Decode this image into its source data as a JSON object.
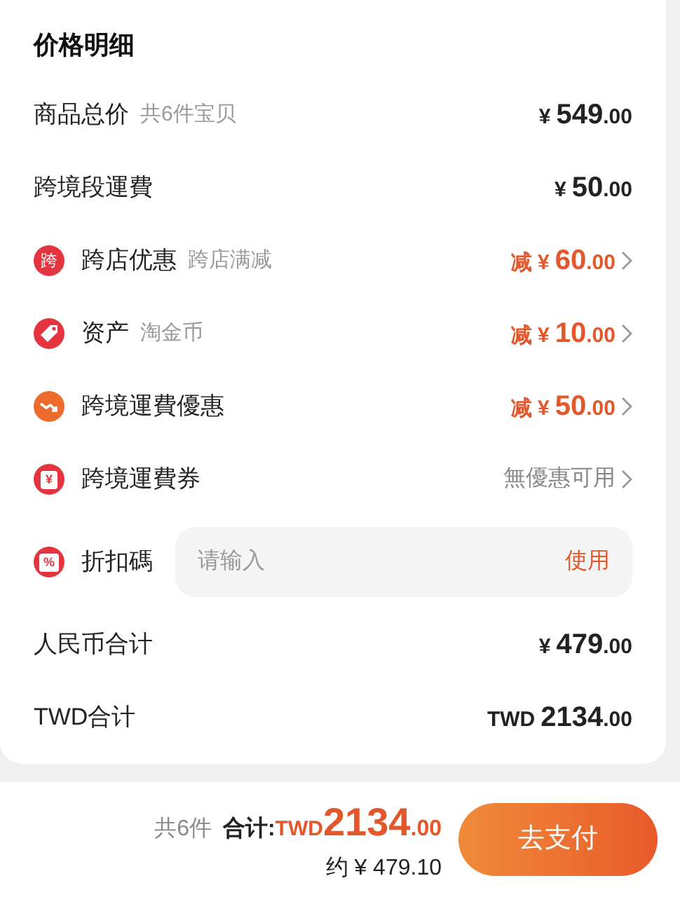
{
  "title": "价格明细",
  "rows": [
    {
      "kind": "price",
      "label": "商品总价",
      "note": "共6件宝贝",
      "prefix": "¥",
      "amount": "549",
      "cents": ".00"
    },
    {
      "kind": "price",
      "label": "跨境段運費",
      "prefix": "¥",
      "amount": "50",
      "cents": ".00"
    },
    {
      "kind": "discount",
      "icon_text": "跨",
      "label": "跨店优惠",
      "note": "跨店满减",
      "prefix": "减 ¥",
      "amount": "60",
      "cents": ".00"
    },
    {
      "kind": "discount",
      "label": "资产",
      "note": "淘金币",
      "prefix": "减 ¥",
      "amount": "10",
      "cents": ".00"
    },
    {
      "kind": "discount",
      "label": "跨境運費優惠",
      "prefix": "减 ¥",
      "amount": "50",
      "cents": ".00"
    },
    {
      "kind": "status",
      "icon_text": "¥",
      "label": "跨境運費券",
      "status": "無優惠可用"
    },
    {
      "kind": "code",
      "icon_text": "%",
      "label": "折扣碼",
      "placeholder": "请输入",
      "action": "使用"
    },
    {
      "kind": "price",
      "label": "人民币合计",
      "prefix": "¥",
      "amount": "479",
      "cents": ".00"
    },
    {
      "kind": "price",
      "label": "TWD合计",
      "prefix": "TWD",
      "amount": "2134",
      "cents": ".00"
    }
  ],
  "footer": {
    "count": "共6件",
    "total_label": "合计:",
    "currency": "TWD",
    "amount": "2134",
    "cents": ".00",
    "approx": "约 ¥ 479.10",
    "button": "去支付"
  }
}
